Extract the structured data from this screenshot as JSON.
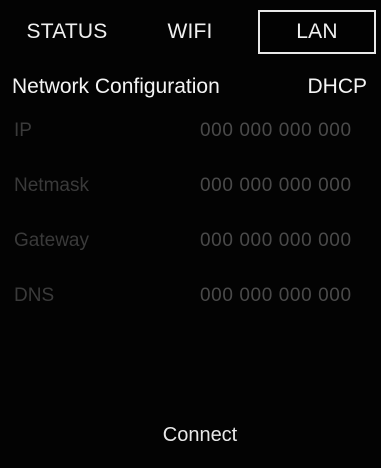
{
  "tabs": {
    "status": "STATUS",
    "wifi": "WIFI",
    "lan": "LAN"
  },
  "config": {
    "label": "Network Configuration",
    "mode": "DHCP"
  },
  "fields": {
    "ip": {
      "label": "IP",
      "value": "000 000 000 000"
    },
    "netmask": {
      "label": "Netmask",
      "value": "000 000 000 000"
    },
    "gateway": {
      "label": "Gateway",
      "value": "000 000 000 000"
    },
    "dns": {
      "label": "DNS",
      "value": "000 000 000 000"
    }
  },
  "actions": {
    "connect": "Connect"
  }
}
